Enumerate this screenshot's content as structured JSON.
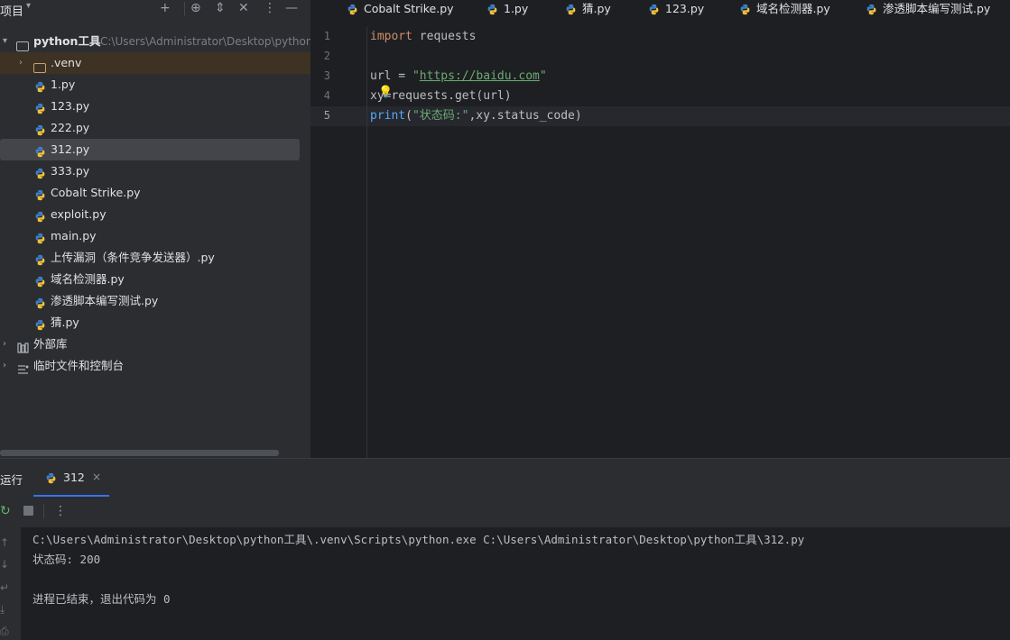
{
  "project": {
    "title": "项目",
    "root": {
      "name": "python工具",
      "path": "C:\\Users\\Administrator\\Desktop\\python"
    },
    "items": [
      {
        "label": ".venv"
      },
      {
        "label": "1.py"
      },
      {
        "label": "123.py"
      },
      {
        "label": "222.py"
      },
      {
        "label": "312.py"
      },
      {
        "label": "333.py"
      },
      {
        "label": "Cobalt Strike.py"
      },
      {
        "label": "exploit.py"
      },
      {
        "label": "main.py"
      },
      {
        "label": "上传漏洞（条件竞争发送器）.py"
      },
      {
        "label": "域名检测器.py"
      },
      {
        "label": "渗透脚本编写测试.py"
      },
      {
        "label": "猜.py"
      }
    ],
    "external_libraries": "外部库",
    "scratches": "临时文件和控制台"
  },
  "editor": {
    "tabs": [
      "Cobalt Strike.py",
      "1.py",
      "猜.py",
      "123.py",
      "域名检测器.py",
      "渗透脚本编写测试.py"
    ],
    "line_numbers": [
      "1",
      "2",
      "3",
      "4",
      "5"
    ],
    "active_line": 5,
    "code": {
      "l1_kw": "import",
      "l1_rest": " requests",
      "l3_pre": "url = ",
      "l3_q1": "\"",
      "l3_url": "https://baidu.com",
      "l3_q2": "\"",
      "l4_a": "xy",
      "l4_b": "=requests.",
      "l4_fn": "get",
      "l4_c": "(url)",
      "l5_fn": "print",
      "l5_a": "(",
      "l5_str": "\"状态码:\"",
      "l5_b": ",xy.status_code)"
    }
  },
  "run": {
    "title": "运行",
    "tab_label": "312",
    "console": [
      "C:\\Users\\Administrator\\Desktop\\python工具\\.venv\\Scripts\\python.exe C:\\Users\\Administrator\\Desktop\\python工具\\312.py",
      "状态码: 200",
      "",
      "进程已结束，退出代码为 0"
    ]
  },
  "colors": {
    "panel_bg": "#2b2d30",
    "editor_bg": "#1e1f22",
    "keyword": "#cf8e6d",
    "string": "#6aab73",
    "function": "#56a8f5",
    "accent": "#3574f0",
    "selection": "#43454a",
    "venv_highlight": "#3d3223"
  },
  "icons": {
    "python_file": "python-file-icon",
    "folder": "folder-icon",
    "library": "library-icon",
    "rerun": "rerun-icon",
    "stop": "stop-icon",
    "more": "more-icon",
    "bulb": "intention-bulb-icon"
  }
}
